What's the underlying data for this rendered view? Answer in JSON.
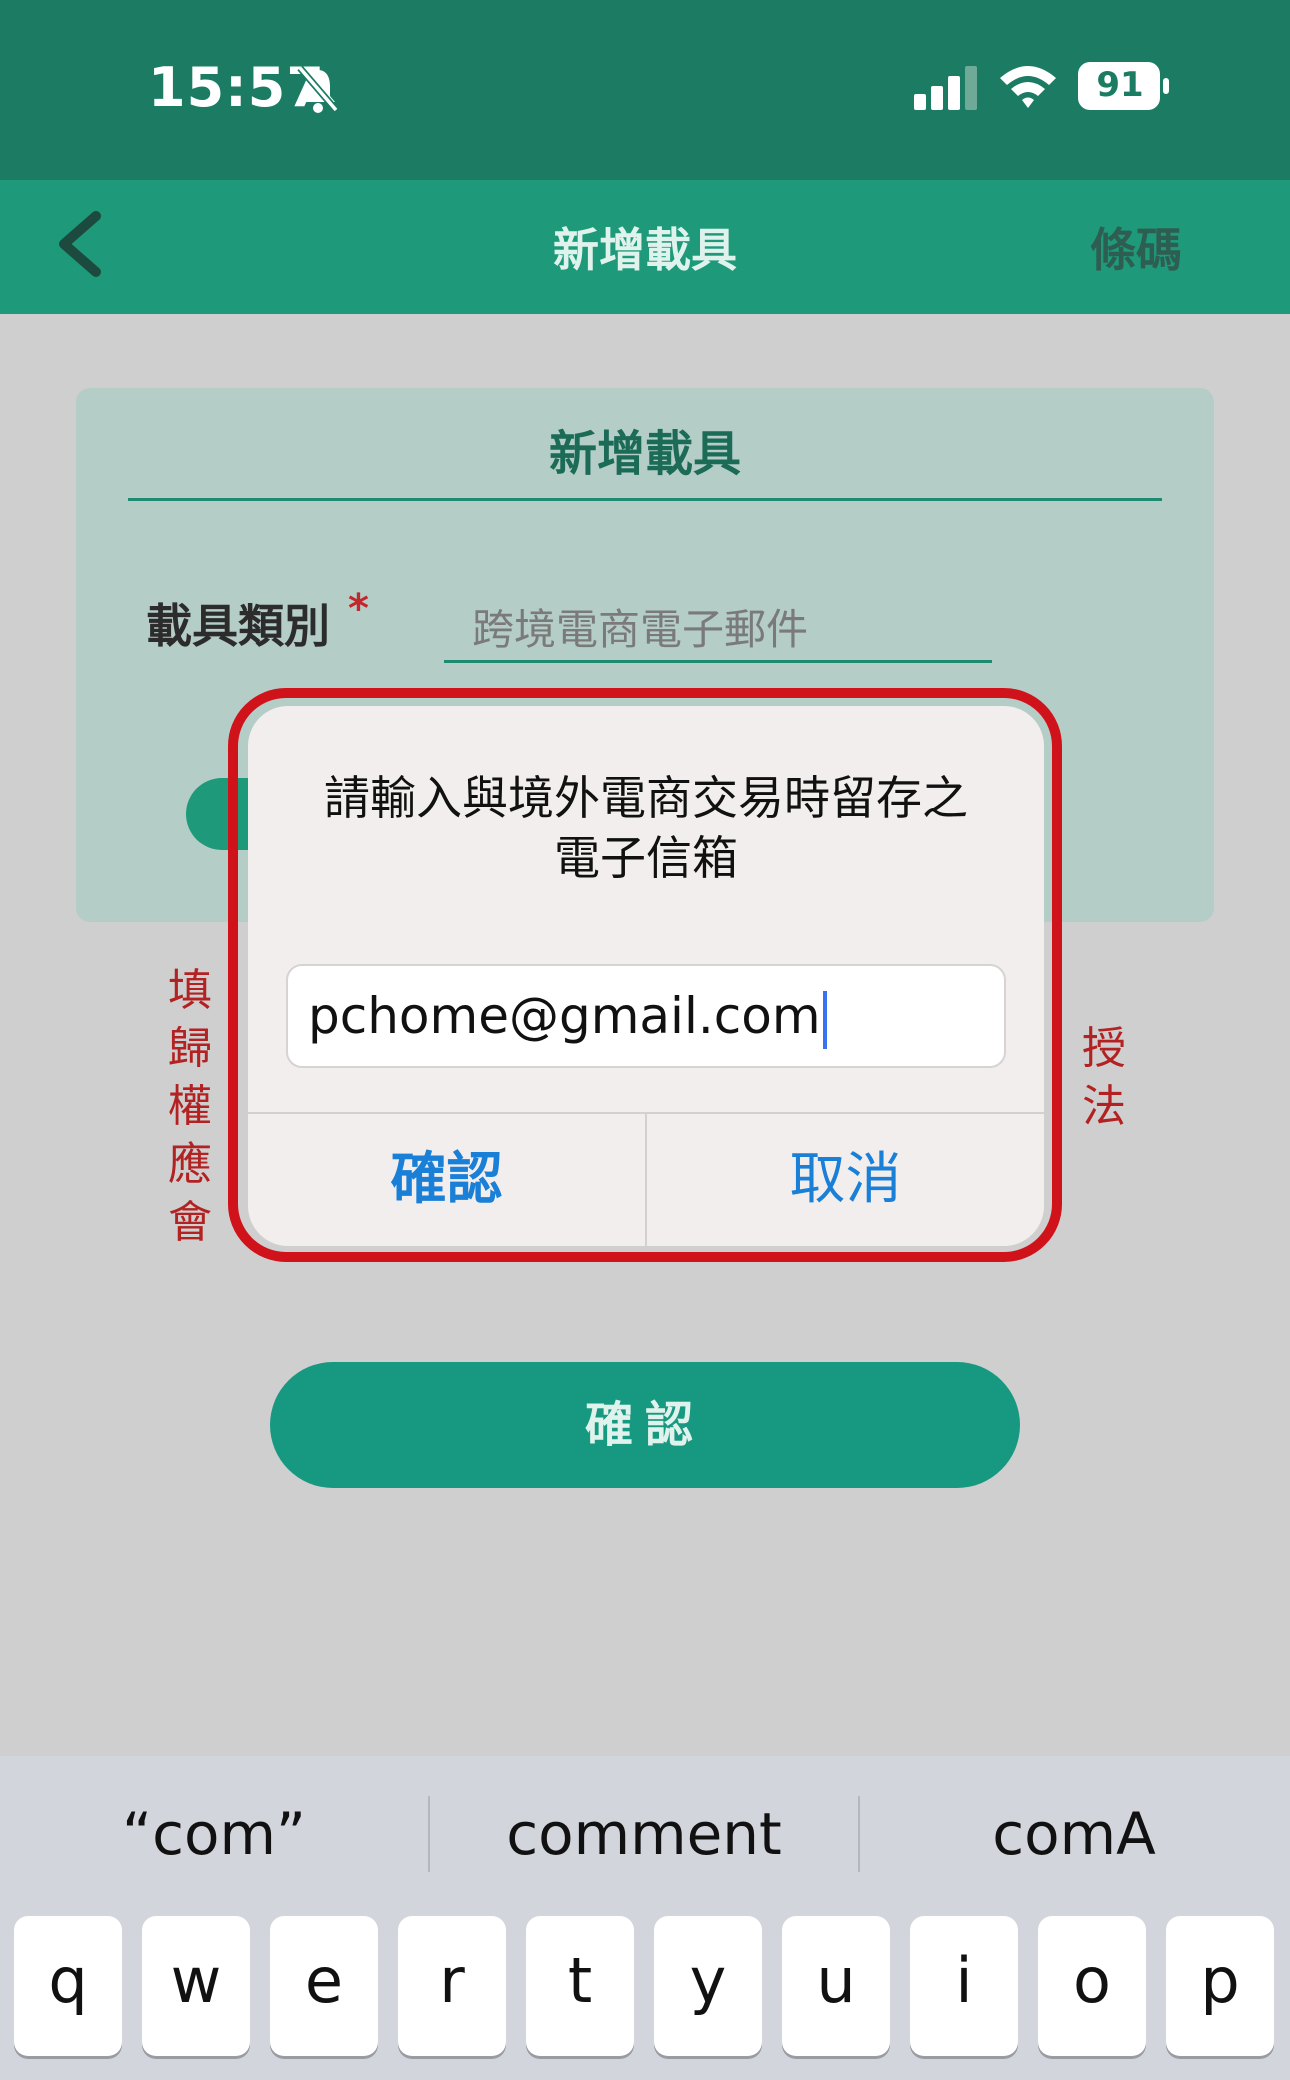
{
  "status_bar": {
    "time": "15:57",
    "battery": "91"
  },
  "nav": {
    "title": "新增載具",
    "right_label": "條碼"
  },
  "card": {
    "title": "新增載具",
    "field_label": "載具類別",
    "required_mark": "*",
    "field_value": "跨境電商電子郵件"
  },
  "warning": {
    "left_chars": "填\n歸\n權\n應\n會",
    "right_chars": "授\n法"
  },
  "main_confirm": "確認",
  "alert": {
    "message": "請輸入與境外電商交易時留存之電子信箱",
    "input_value": "pchome@gmail.com",
    "confirm_label": "確認",
    "cancel_label": "取消"
  },
  "keyboard": {
    "suggestions": [
      "“com”",
      "comment",
      "comA"
    ],
    "row1": [
      "q",
      "w",
      "e",
      "r",
      "t",
      "y",
      "u",
      "i",
      "o",
      "p"
    ]
  },
  "colors": {
    "header": "#1b7c63",
    "nav": "#1e9a7b",
    "accent": "#179880",
    "alert_button": "#1a7fd6",
    "highlight": "#d0121b"
  }
}
